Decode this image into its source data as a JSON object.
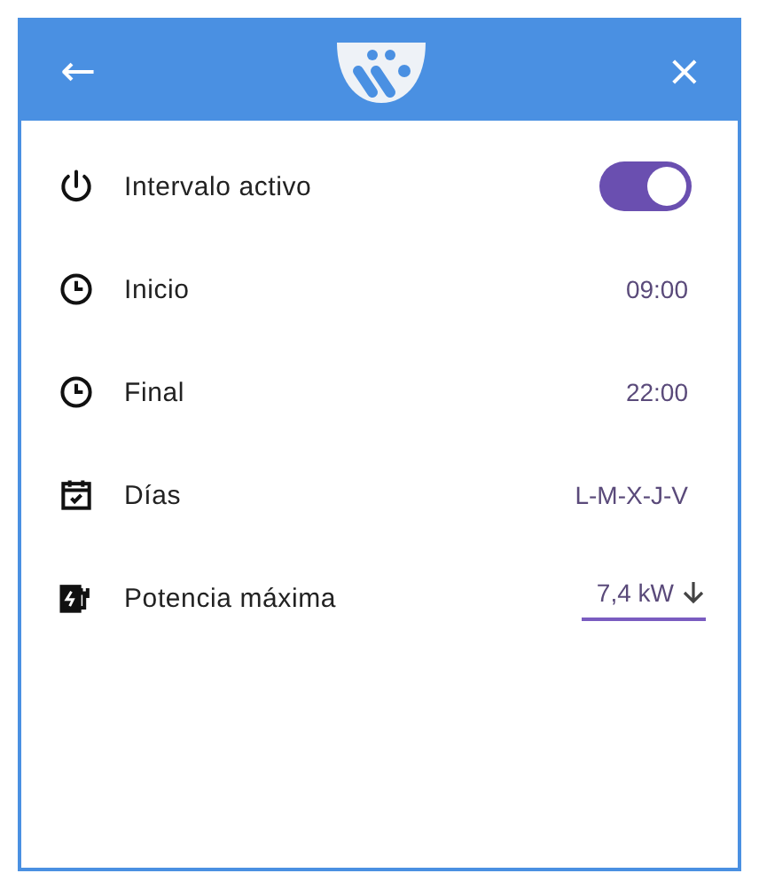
{
  "header": {
    "back": "←",
    "close": "×"
  },
  "settings": [
    {
      "kind": "toggle",
      "label": "Intervalo activo",
      "on": true
    },
    {
      "kind": "value",
      "label": "Inicio",
      "value": "09:00"
    },
    {
      "kind": "value",
      "label": "Final",
      "value": "22:00"
    },
    {
      "kind": "value",
      "label": "Días",
      "value": "L-M-X-J-V"
    },
    {
      "kind": "select",
      "label": "Potencia máxima",
      "value": "7,4 kW"
    }
  ]
}
